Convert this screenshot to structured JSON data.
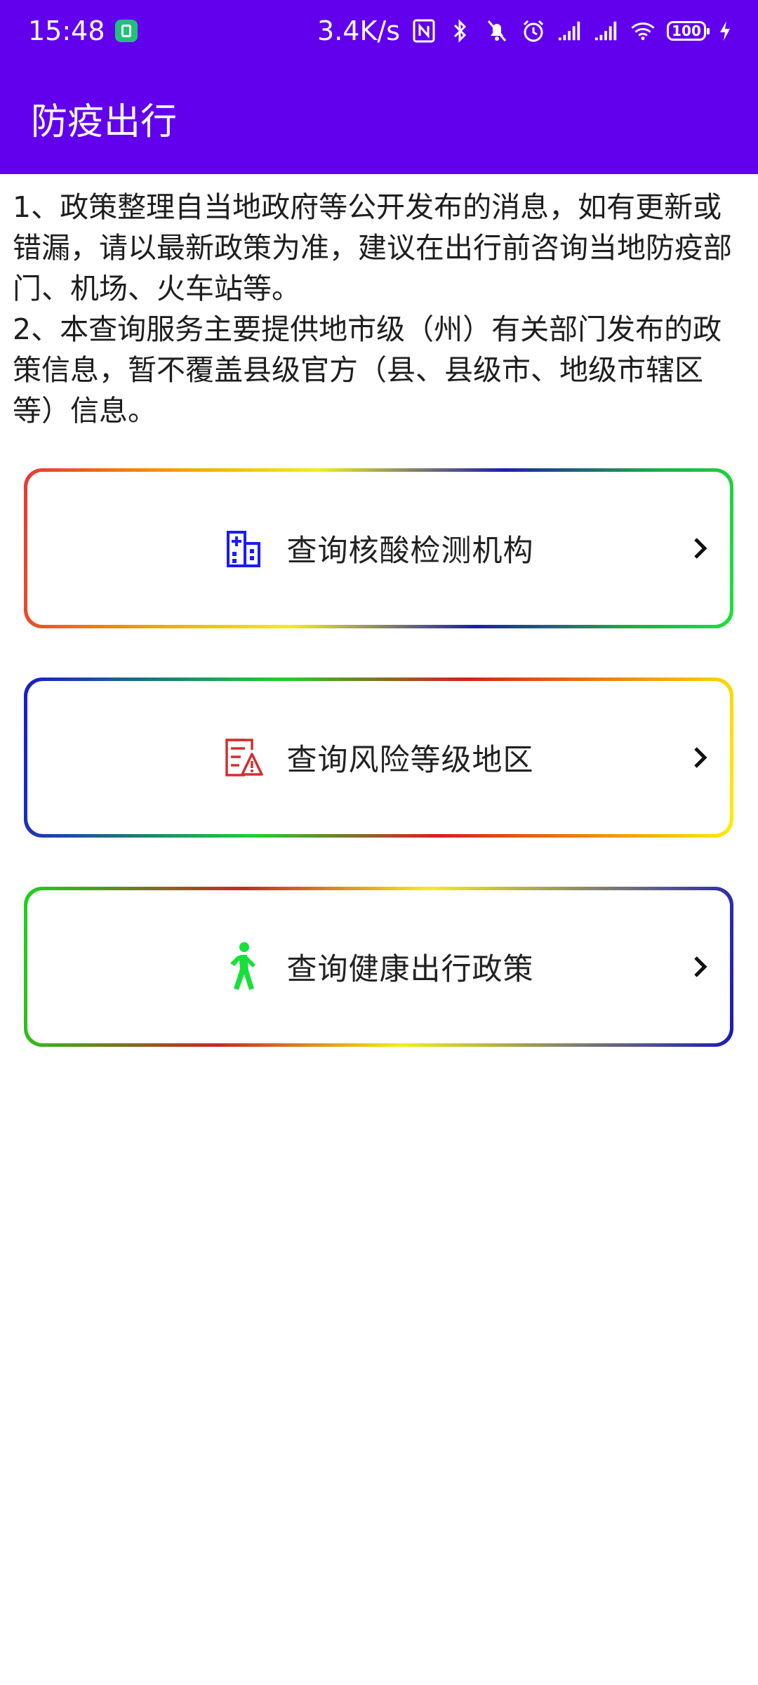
{
  "status_bar": {
    "time": "15:48",
    "net_speed": "3.4K/s",
    "battery": "100",
    "icons": [
      "app-notification-icon",
      "nfc-icon",
      "bluetooth-icon",
      "mute-icon",
      "alarm-icon",
      "signal-icon",
      "signal-icon",
      "wifi-icon",
      "battery-icon",
      "charging-icon"
    ]
  },
  "app_bar": {
    "title": "防疫出行",
    "color": "#6200ee"
  },
  "notes": {
    "line1": "1、政策整理自当地政府等公开发布的消息，如有更新或错漏，请以最新政策为准，建议在出行前咨询当地防疫部门、机场、火车站等。",
    "line2": "2、本查询服务主要提供地市级（州）有关部门发布的政策信息，暂不覆盖县级官方（县、县级市、地级市辖区等）信息。"
  },
  "cards": [
    {
      "label": "查询核酸检测机构",
      "icon": "hospital-icon",
      "icon_color": "#1a1aff"
    },
    {
      "label": "查询风险等级地区",
      "icon": "warning-document-icon",
      "icon_color": "#d32f2f"
    },
    {
      "label": "查询健康出行政策",
      "icon": "walking-person-icon",
      "icon_color": "#18e03a"
    }
  ]
}
